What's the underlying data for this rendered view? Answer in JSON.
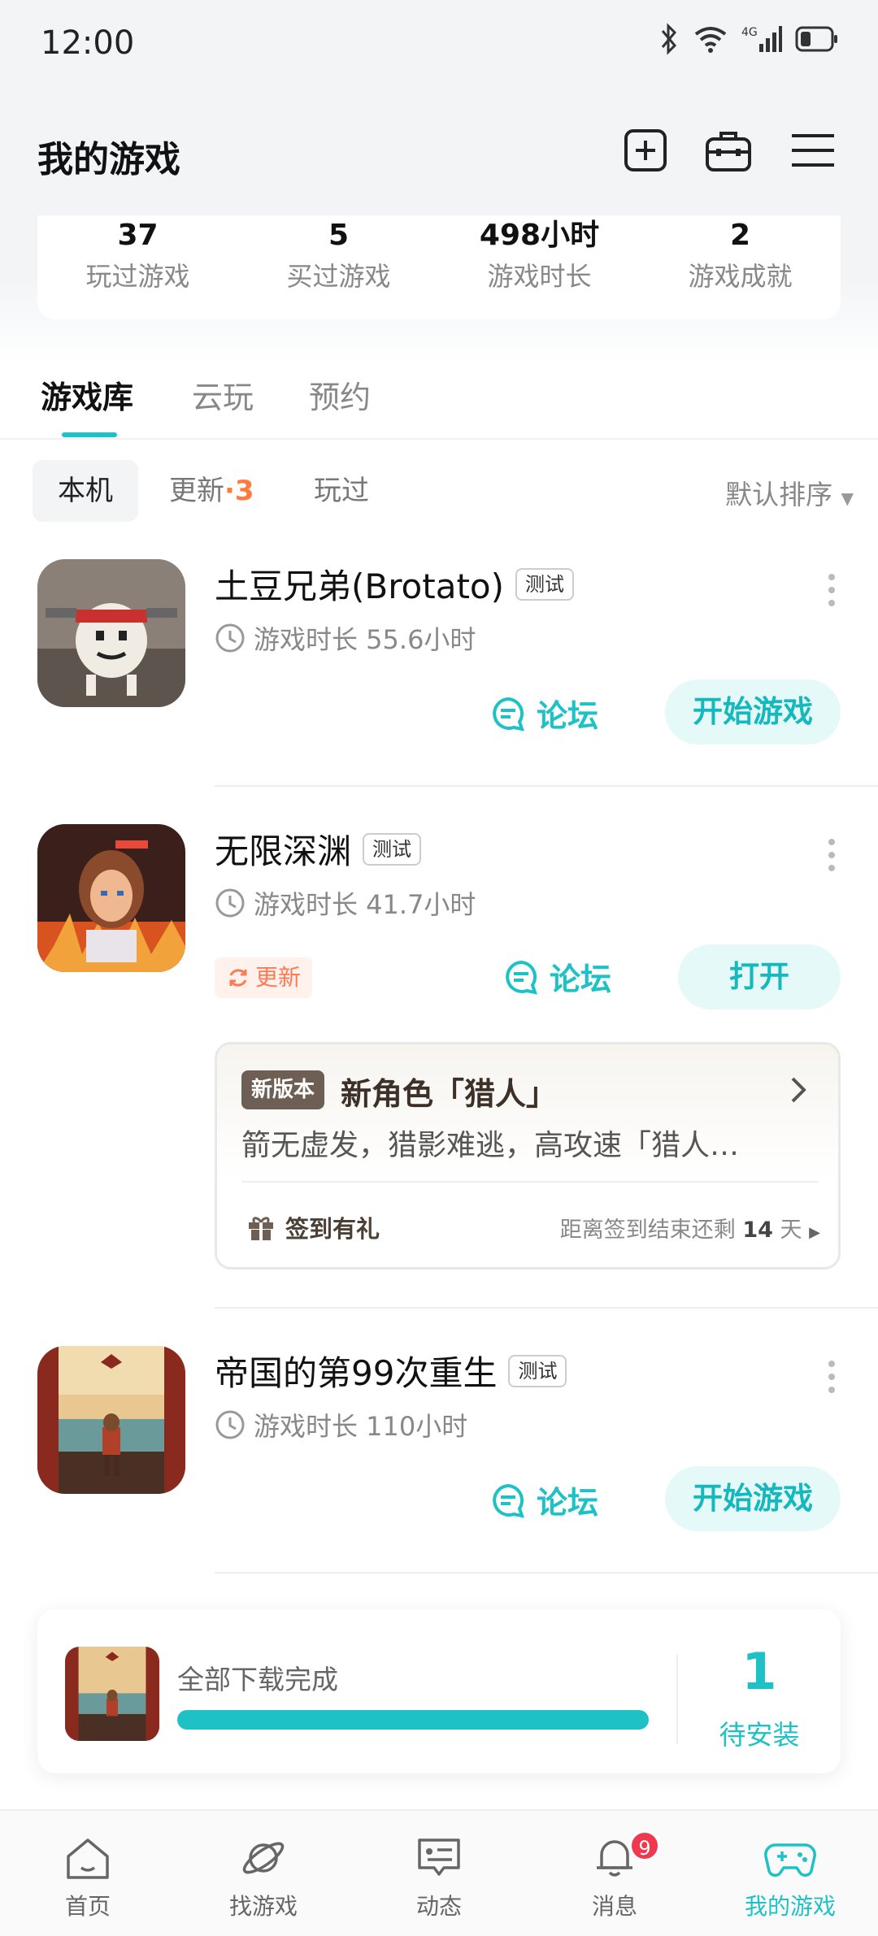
{
  "status_bar": {
    "time": "12:00",
    "network": "4G"
  },
  "header": {
    "title": "我的游戏"
  },
  "stats": [
    {
      "value": "37",
      "label": "玩过游戏"
    },
    {
      "value": "5",
      "label": "买过游戏"
    },
    {
      "value": "498小时",
      "label": "游戏时长"
    },
    {
      "value": "2",
      "label": "游戏成就"
    }
  ],
  "main_tabs": [
    "游戏库",
    "云玩",
    "预约"
  ],
  "filters": {
    "local": "本机",
    "update": "更新",
    "update_sep": "·",
    "update_count": "3",
    "played": "玩过",
    "sort": "默认排序"
  },
  "games": [
    {
      "name": "土豆兄弟(Brotato)",
      "tag": "测试",
      "playtime": "游戏时长 55.6小时",
      "forum": "论坛",
      "action": "开始游戏"
    },
    {
      "name": "无限深渊",
      "tag": "测试",
      "playtime": "游戏时长 41.7小时",
      "update_tag": "更新",
      "forum": "论坛",
      "action": "打开"
    },
    {
      "name": "帝国的第99次重生",
      "tag": "测试",
      "playtime": "游戏时长 110小时",
      "forum": "论坛",
      "action": "开始游戏"
    }
  ],
  "news_card": {
    "badge": "新版本",
    "title": "新角色「猎人」",
    "desc": "箭无虚发，猎影难逃，高攻速「猎人…",
    "sign_in": "签到有礼",
    "remain_prefix": "距离签到结束还剩 ",
    "remain_days": "14",
    "remain_suffix": " 天"
  },
  "download_banner": {
    "label": "全部下载完成",
    "progress": 1.0,
    "count": "1",
    "pending": "待安装"
  },
  "bottom_nav": [
    {
      "label": "首页",
      "icon": "home-icon"
    },
    {
      "label": "找游戏",
      "icon": "planet-icon"
    },
    {
      "label": "动态",
      "icon": "feed-icon"
    },
    {
      "label": "消息",
      "icon": "bell-icon",
      "badge": "9"
    },
    {
      "label": "我的游戏",
      "icon": "gamepad-icon"
    }
  ],
  "colors": {
    "accent": "#1ec2c6",
    "update": "#ff7a3c",
    "badge": "#f0384f"
  }
}
